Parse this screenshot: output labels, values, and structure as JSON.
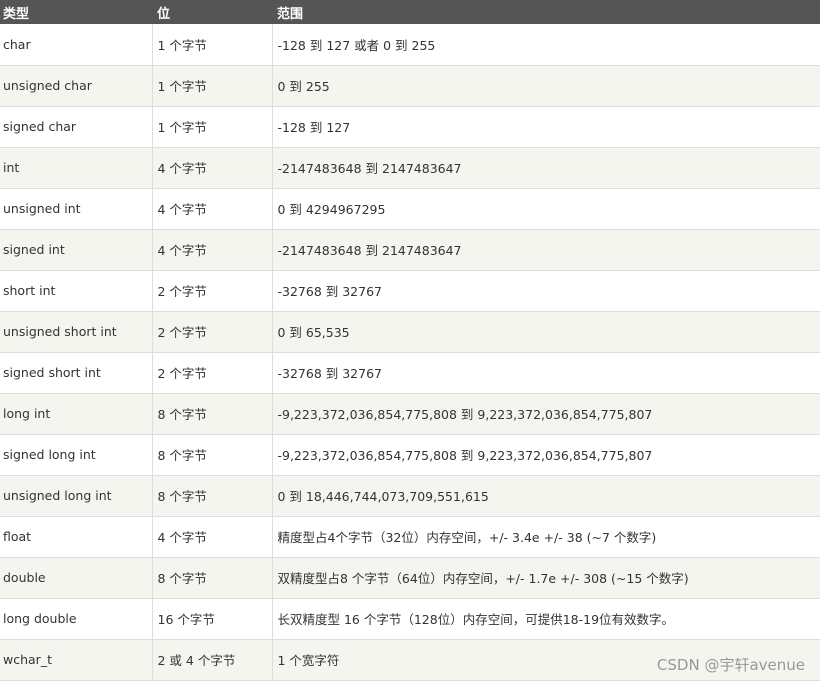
{
  "table": {
    "headers": [
      "类型",
      "位",
      "范围"
    ],
    "rows": [
      [
        "char",
        "1 个字节",
        "-128 到 127 或者 0 到 255"
      ],
      [
        "unsigned char",
        "1 个字节",
        "0 到 255"
      ],
      [
        "signed char",
        "1 个字节",
        "-128 到 127"
      ],
      [
        "int",
        "4 个字节",
        "-2147483648 到 2147483647"
      ],
      [
        "unsigned int",
        "4 个字节",
        "0 到 4294967295"
      ],
      [
        "signed int",
        "4 个字节",
        "-2147483648 到 2147483647"
      ],
      [
        "short int",
        "2 个字节",
        "-32768 到 32767"
      ],
      [
        "unsigned short int",
        "2 个字节",
        "0 到 65,535"
      ],
      [
        "signed short int",
        "2 个字节",
        "-32768 到 32767"
      ],
      [
        "long int",
        "8 个字节",
        "-9,223,372,036,854,775,808 到 9,223,372,036,854,775,807"
      ],
      [
        "signed long int",
        "8 个字节",
        "-9,223,372,036,854,775,808 到 9,223,372,036,854,775,807"
      ],
      [
        "unsigned long int",
        "8 个字节",
        "0 到 18,446,744,073,709,551,615"
      ],
      [
        "float",
        "4 个字节",
        "精度型占4个字节（32位）内存空间，+/- 3.4e +/- 38 (~7 个数字)"
      ],
      [
        "double",
        "8 个字节",
        "双精度型占8 个字节（64位）内存空间，+/- 1.7e +/- 308 (~15 个数字)"
      ],
      [
        "long double",
        "16 个字节",
        "长双精度型 16 个字节（128位）内存空间，可提供18-19位有效数字。"
      ],
      [
        "wchar_t",
        "2 或 4 个字节",
        "1 个宽字符"
      ]
    ]
  },
  "watermark": "CSDN @宇轩avenue"
}
